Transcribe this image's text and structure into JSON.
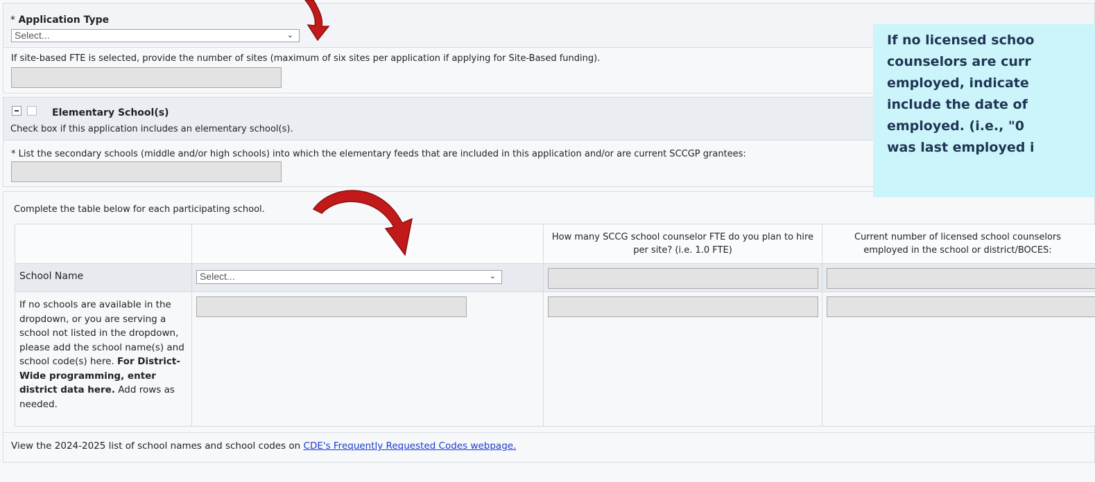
{
  "application_type": {
    "required_mark": "*",
    "label": "Application Type",
    "select_value": "Select..."
  },
  "sites": {
    "instruction": "If site-based FTE is selected, provide the number of sites (maximum of six sites per application if applying for Site-Based funding).",
    "value": ""
  },
  "elementary": {
    "label": "Elementary School(s)",
    "help": "Check box if this application includes an elementary school(s).",
    "checked": false,
    "secondary_prompt": "* List the secondary schools (middle and/or high schools) into which the elementary feeds that are included in this application and/or are current SCCGP grantees:",
    "secondary_value": ""
  },
  "callout": {
    "lines": [
      "If no licensed schoo",
      "counselors are curr",
      "employed, indicate",
      "include the date of",
      "employed. (i.e., \"0",
      "was last employed i"
    ]
  },
  "table": {
    "intro": "Complete the table below for each participating school.",
    "headers": {
      "col1": "",
      "col2": "",
      "col3": "How many SCCG school counselor FTE do you plan to hire per site? (i.e. 1.0 FTE)",
      "col4": "Current number of licensed school counselors employed in the school or district/BOCES:"
    },
    "row1": {
      "label": "School Name",
      "select_value": "Select..."
    },
    "row2": {
      "label_intro": "If no schools are available in the dropdown, or you are serving a school not listed in the dropdown, please add the school name(s) and school code(s) here. ",
      "label_bold": "For District-Wide programming, enter district data here.",
      "label_outro": " Add rows as needed."
    }
  },
  "footer": {
    "text": "View the 2024-2025 list of school names and school codes on ",
    "link": "CDE's Frequently Requested Codes webpage."
  },
  "colors": {
    "callout_bg": "#ccf5fb",
    "arrow": "#c21a1a",
    "link": "#1a3dcc"
  }
}
